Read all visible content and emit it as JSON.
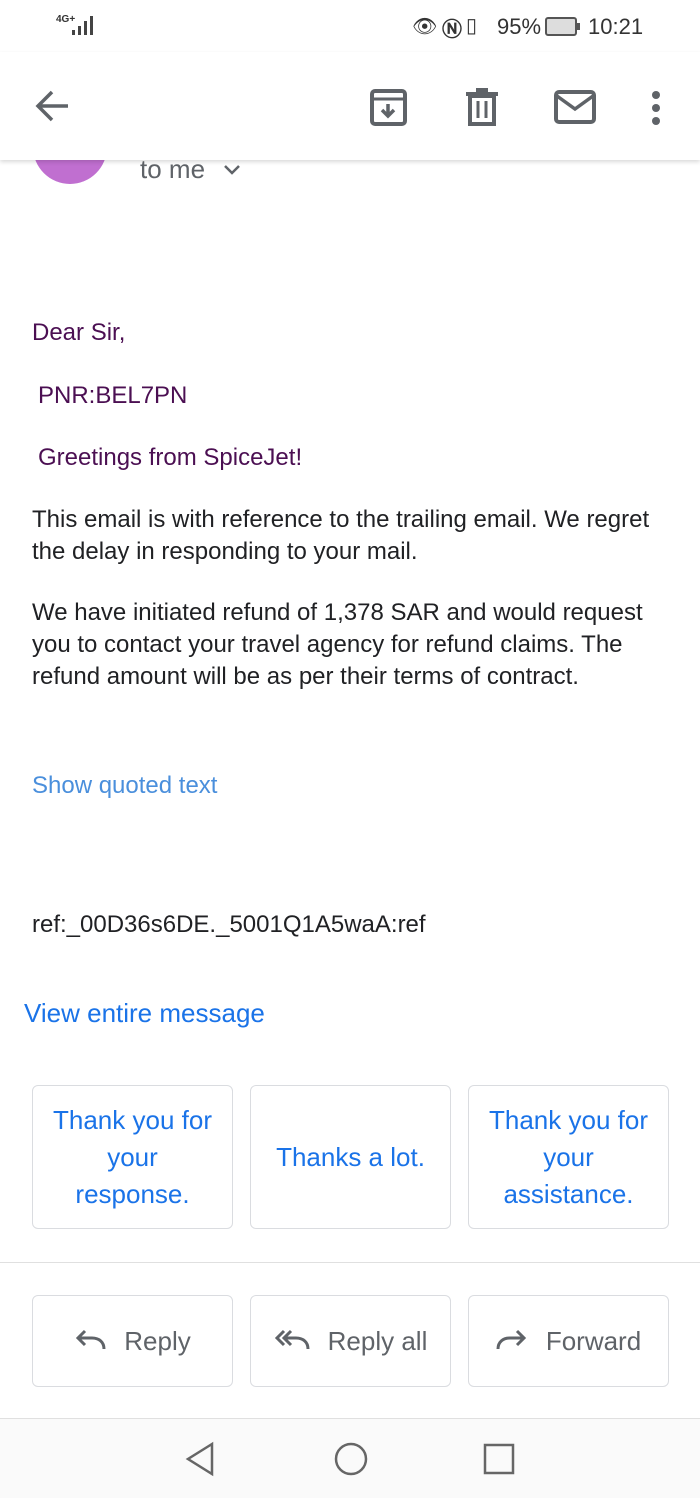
{
  "status_bar": {
    "network": "4G+",
    "battery": "95%",
    "time": "10:21"
  },
  "app_bar": {
    "back": "arrow-back-icon",
    "archive": "archive-icon",
    "delete": "trash-icon",
    "mark_unread": "mail-icon",
    "more": "more-vert-icon"
  },
  "header": {
    "recipient": "to me",
    "avatar_color": "#c06fd0"
  },
  "body": {
    "greeting": "Dear Sir,",
    "pnr": "PNR:BEL7PN",
    "greetings": "Greetings from SpiceJet!",
    "para1": "This email is with reference to the trailing email. We regret the delay in responding to your mail.",
    "para2": "We have initiated refund of 1,378 SAR and would request you to contact your travel agency  for refund claims. The refund amount will be as per their terms of contract.",
    "show_quoted": "Show quoted text",
    "ref": "ref:_00D36s6DE._5001Q1A5waA:ref",
    "view_entire": "View entire message"
  },
  "smart_replies": [
    "Thank you for your response.",
    "Thanks a lot.",
    "Thank you for your assistance."
  ],
  "actions": {
    "reply": "Reply",
    "reply_all": "Reply all",
    "forward": "Forward"
  }
}
